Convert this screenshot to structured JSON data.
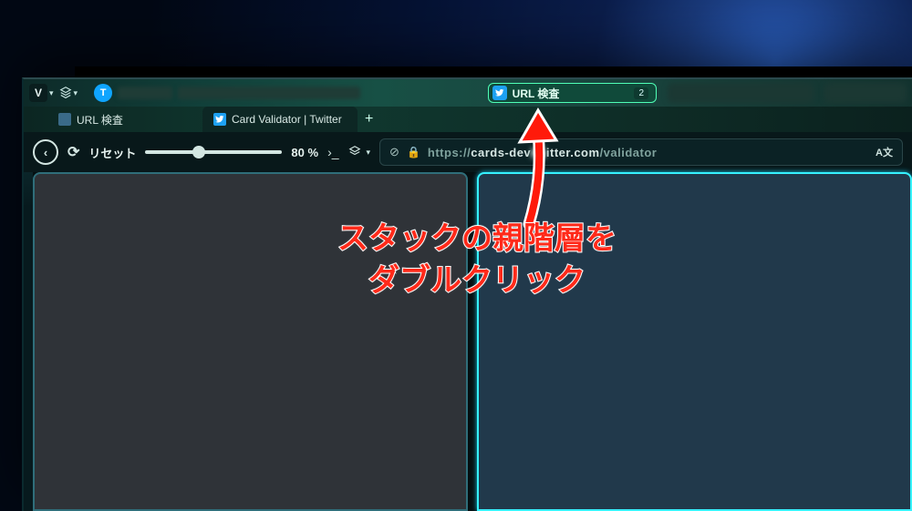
{
  "titlebar": {
    "logo_letter": "V",
    "t_letter": "T",
    "stack_pill": {
      "label": "URL 検査",
      "count": "2"
    }
  },
  "tabs": {
    "tab1_label": "URL 検査",
    "tab2_label": "Card Validator | Twitter",
    "newtab_glyph": "+"
  },
  "toolbar": {
    "back_glyph": "‹",
    "reload_glyph": "⟳",
    "reset_label": "リセット",
    "zoom_value": "80 %",
    "console_glyph": "›_",
    "stack2_glyph": "≡",
    "shield_glyph": "⊘",
    "lock_glyph": "🔒",
    "url_scheme": "https://",
    "url_host_pre": "cards-dev",
    "url_host_obscured": "■■",
    "url_host_post": "itter.com",
    "url_path": "/validator",
    "translate_label": "A文"
  },
  "annotation": {
    "line1": "スタックの親階層を",
    "line2": "ダブルクリック"
  }
}
